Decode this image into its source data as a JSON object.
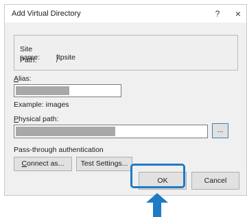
{
  "dialog": {
    "title": "Add Virtual Directory",
    "help_glyph": "?",
    "close_glyph": "×"
  },
  "info": {
    "site_name_label": "Site name:",
    "site_name_value": "ftpsite",
    "path_label": "Path:",
    "path_value": "/"
  },
  "alias": {
    "label_prefix": "",
    "label_accel": "A",
    "label_rest": "lias:",
    "value_redacted": true,
    "example": "Example: images"
  },
  "physical_path": {
    "label_accel": "P",
    "label_rest": "hysical path:",
    "value_redacted": true,
    "browse_label": "..."
  },
  "auth": {
    "title": "Pass-through authentication",
    "connect_as_accel": "C",
    "connect_as_rest": "onnect as...",
    "test_settings_label": "Test Settings..."
  },
  "footer": {
    "ok_label": "OK",
    "cancel_label": "Cancel"
  },
  "colors": {
    "highlight": "#1e7bc4",
    "dialog_bg": "#f0f0f0",
    "redaction": "#a8a8a8"
  },
  "icons": {
    "close": "close-icon",
    "help": "help-icon",
    "pointer": "pointer-arrow-icon"
  }
}
